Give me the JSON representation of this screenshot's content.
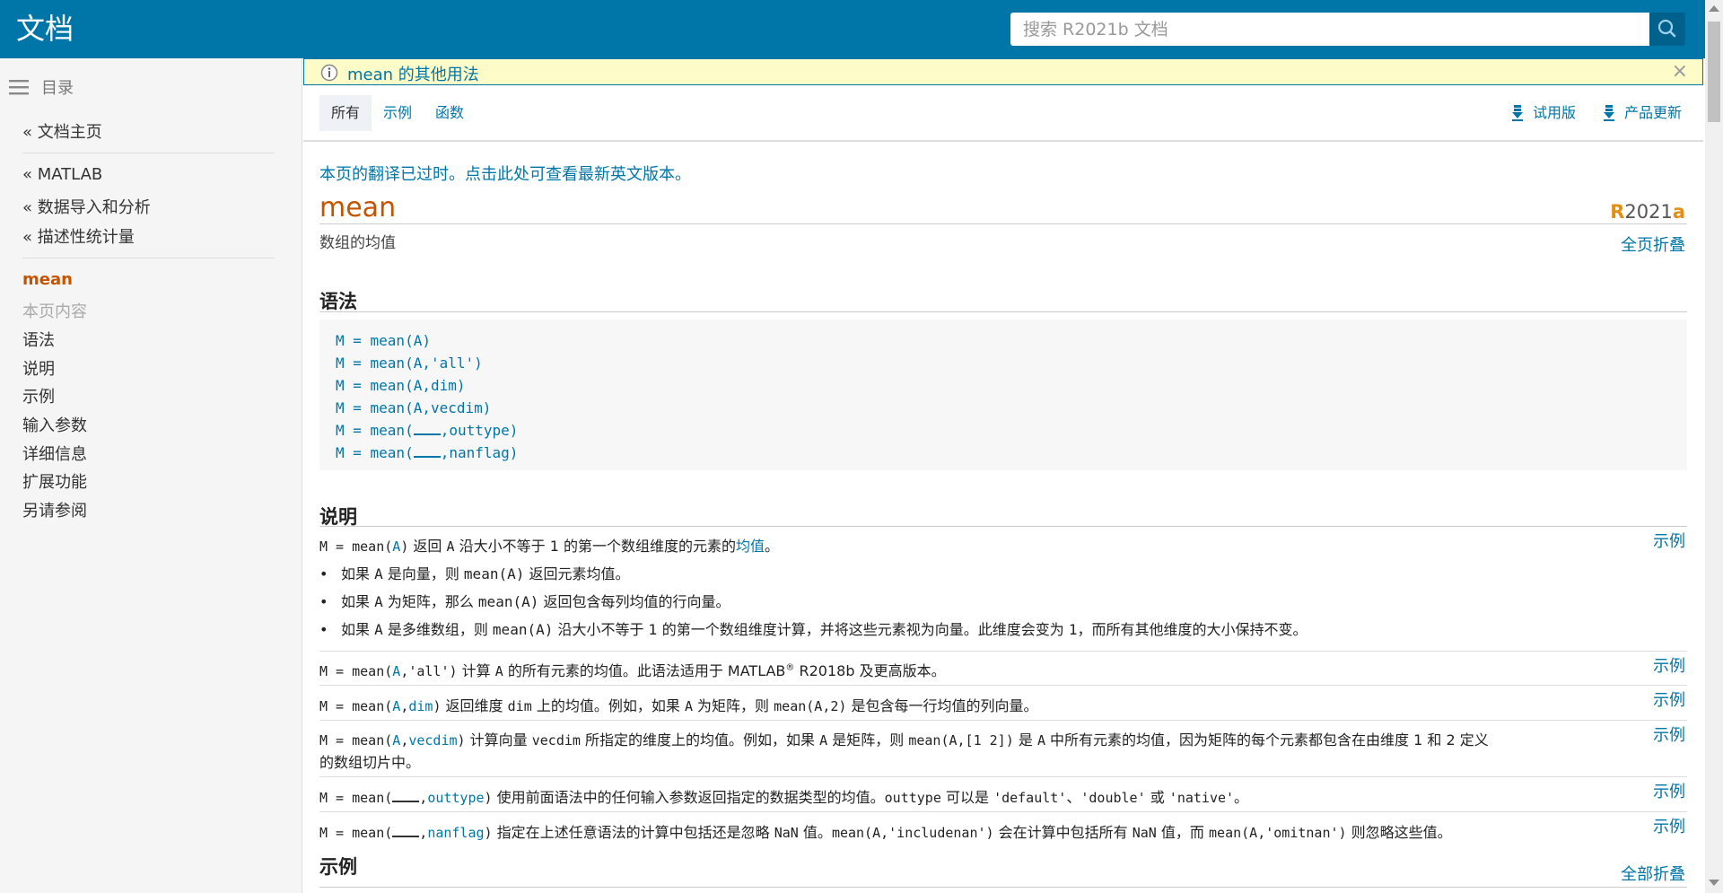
{
  "header": {
    "brand": "文档",
    "search_placeholder": "搜索 R2021b 文档"
  },
  "sidebar": {
    "toc_label": "目录",
    "home": "« 文档主页",
    "breadcrumbs": [
      "« MATLAB",
      "« 数据导入和分析",
      "« 描述性统计量"
    ],
    "current": "mean",
    "on_page_label": "本页内容",
    "on_page_items": [
      "语法",
      "说明",
      "示例",
      "输入参数",
      "详细信息",
      "扩展功能",
      "另请参阅"
    ]
  },
  "notice": {
    "text": "mean 的其他用法"
  },
  "tabs": {
    "all": "所有",
    "examples": "示例",
    "functions": "函数",
    "trial": "试用版",
    "updates": "产品更新"
  },
  "content": {
    "outdated": "本页的翻译已过时。点击此处可查看最新英文版本。",
    "title": "mean",
    "release_r": "R",
    "release_num": "2021",
    "release_a": "a",
    "summary": "数组的均值",
    "collapse_page": "全页折叠",
    "syntax_heading": "语法",
    "syntax": [
      {
        "lhs": "M = ",
        "fn": "mean(A)"
      },
      {
        "lhs": "M = ",
        "fn": "mean(A,'all')"
      },
      {
        "lhs": "M = ",
        "fn": "mean(A,dim)"
      },
      {
        "lhs": "M = ",
        "fn": "mean(A,vecdim)"
      },
      {
        "lhs": "M = ",
        "pre": "mean(",
        "post": ",outtype)"
      },
      {
        "lhs": "M = ",
        "pre": "mean(",
        "post": ",nanflag)"
      }
    ],
    "desc_heading": "说明",
    "example_link": "示例",
    "examples_heading": "示例",
    "collapse_all": "全部折叠",
    "desc": {
      "d1": {
        "code": "M = mean(",
        "arg": "A",
        "close": ")",
        "text1": " 返回 ",
        "code2": "A",
        "text2": " 沿大小不等于 1 的第一个数组维度的元素的",
        "link": "均值",
        "text3": "。"
      },
      "b1": {
        "t1": "如果 ",
        "c1": "A",
        "t2": " 是向量，则 ",
        "c2": "mean(A)",
        "t3": " 返回元素均值。"
      },
      "b2": {
        "t1": "如果 ",
        "c1": "A",
        "t2": " 为矩阵，那么 ",
        "c2": "mean(A)",
        "t3": " 返回包含每列均值的行向量。"
      },
      "b3": {
        "t1": "如果 ",
        "c1": "A",
        "t2": " 是多维数组，则 ",
        "c2": "mean(A)",
        "t3": " 沿大小不等于 1 的第一个数组维度计算，并将这些元素视为向量。此维度会变为 ",
        "c3": "1",
        "t4": "，而所有其他维度的大小保持不变。"
      },
      "d2": {
        "code": "M = mean(",
        "arg": "A",
        "rest": ",'all')",
        "t1": " 计算 ",
        "c1": "A",
        "t2": " 的所有元素的均值。此语法适用于 MATLAB",
        "reg": "®",
        "t3": " R2018b 及更高版本。"
      },
      "d3": {
        "code": "M = mean(",
        "arg": "A",
        "comma": ",",
        "arg2": "dim",
        "close": ")",
        "t1": " 返回维度 ",
        "c1": "dim",
        "t2": " 上的均值。例如，如果 ",
        "c2": "A",
        "t3": " 为矩阵，则 ",
        "c3": "mean(A,2)",
        "t4": " 是包含每一行均值的列向量。"
      },
      "d4": {
        "code": "M = mean(",
        "arg": "A",
        "comma": ",",
        "arg2": "vecdim",
        "close": ")",
        "t1": " 计算向量 ",
        "c1": "vecdim",
        "t2": " 所指定的维度上的均值。例如，如果 ",
        "c2": "A",
        "t3": " 是矩阵，则 ",
        "c3": "mean(A,[1 2])",
        "t4": " 是 ",
        "c4": "A",
        "t5": " 中所有元素的均值，因为矩阵的每个元素都包含在由维度 1 和 2 定义",
        "t6": "的数组切片中。"
      },
      "d5": {
        "code": "M = mean(",
        "comma": ",",
        "arg2": "outtype",
        "close": ")",
        "t1": " 使用前面语法中的任何输入参数返回指定的数据类型的均值。",
        "c1": "outtype",
        "t2": " 可以是 ",
        "c2": "'default'",
        "t3": "、",
        "c3": "'double'",
        "t4": " 或 ",
        "c4": "'native'",
        "t5": "。"
      },
      "d6": {
        "code": "M = mean(",
        "comma": ",",
        "arg2": "nanflag",
        "close": ")",
        "t1": " 指定在上述任意语法的计算中包括还是忽略 ",
        "c1": "NaN",
        "t2": " 值。",
        "c2": "mean(A,'includenan')",
        "t3": " 会在计算中包括所有 ",
        "c3": "NaN",
        "t4": " 值，而 ",
        "c4": "mean(A,'omitnan')",
        "t5": " 则忽略这些值。"
      }
    }
  }
}
